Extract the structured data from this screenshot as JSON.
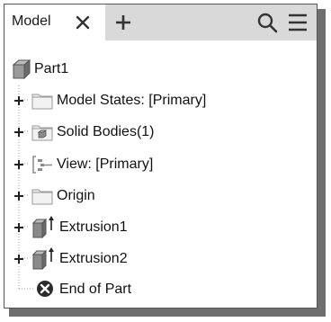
{
  "browser": {
    "tab_label": "Model",
    "icons": {
      "close": "close-icon",
      "add": "plus-icon",
      "search": "search-icon",
      "menu": "hamburger-menu-icon"
    }
  },
  "tree": {
    "root": {
      "label": "Part1",
      "icon": "part-cube-icon"
    },
    "items": [
      {
        "label": "Model States: [Primary]",
        "icon": "folder-icon",
        "expandable": true
      },
      {
        "label": "Solid Bodies(1)",
        "icon": "solid-bodies-folder-icon",
        "expandable": true
      },
      {
        "label": "View: [Primary]",
        "icon": "view-rep-icon",
        "expandable": true
      },
      {
        "label": "Origin",
        "icon": "folder-icon",
        "expandable": true
      },
      {
        "label": "Extrusion1",
        "icon": "extrusion-icon",
        "expandable": true
      },
      {
        "label": "Extrusion2",
        "icon": "extrusion-icon",
        "expandable": true
      },
      {
        "label": "End of Part",
        "icon": "end-of-part-icon",
        "expandable": false
      }
    ]
  },
  "colors": {
    "tabbar_bg": "#d9d9d9",
    "icon_gray": "#8a8a8a",
    "text": "#111111",
    "shadow": "#6e6e6e"
  }
}
